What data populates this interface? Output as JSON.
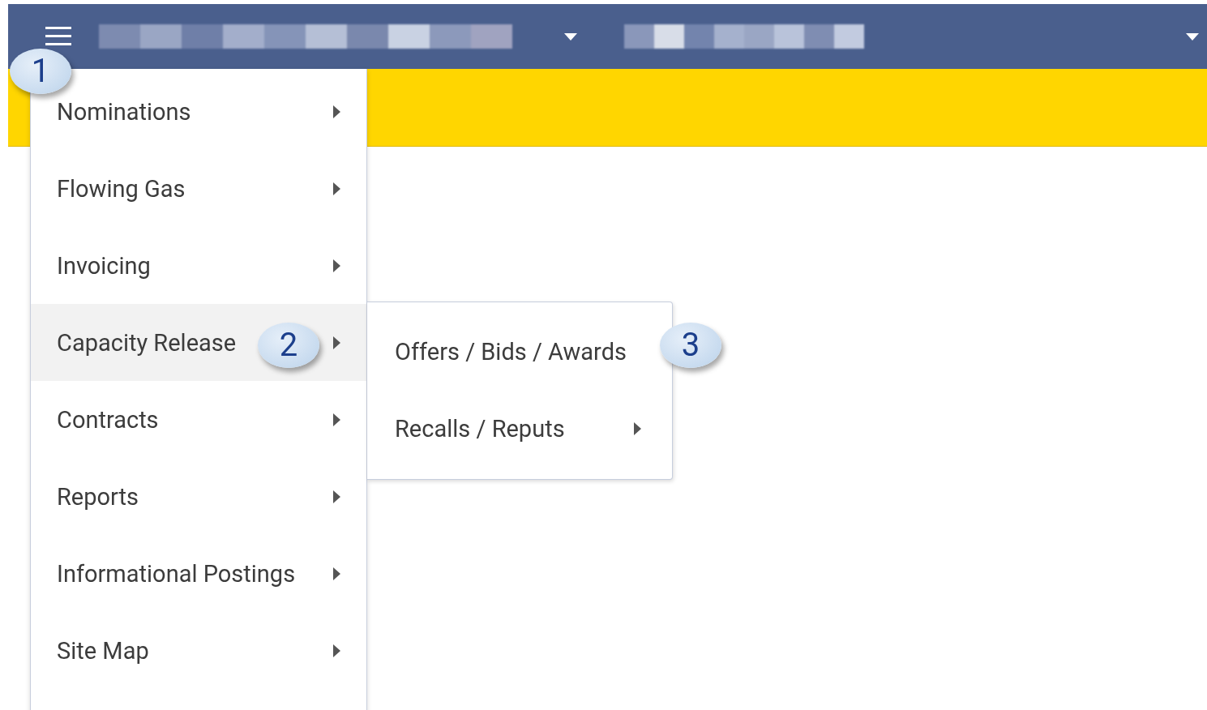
{
  "menu": {
    "items": [
      {
        "label": "Nominations",
        "selected": false,
        "has_submenu": true
      },
      {
        "label": "Flowing Gas",
        "selected": false,
        "has_submenu": true
      },
      {
        "label": "Invoicing",
        "selected": false,
        "has_submenu": true
      },
      {
        "label": "Capacity Release",
        "selected": true,
        "has_submenu": true
      },
      {
        "label": "Contracts",
        "selected": false,
        "has_submenu": true
      },
      {
        "label": "Reports",
        "selected": false,
        "has_submenu": true
      },
      {
        "label": "Informational Postings",
        "selected": false,
        "has_submenu": true
      },
      {
        "label": "Site Map",
        "selected": false,
        "has_submenu": true
      }
    ]
  },
  "submenu": {
    "items": [
      {
        "label": "Offers / Bids / Awards",
        "has_submenu": false
      },
      {
        "label": "Recalls / Reputs",
        "has_submenu": true
      }
    ]
  },
  "callouts": [
    "1",
    "2",
    "3"
  ]
}
